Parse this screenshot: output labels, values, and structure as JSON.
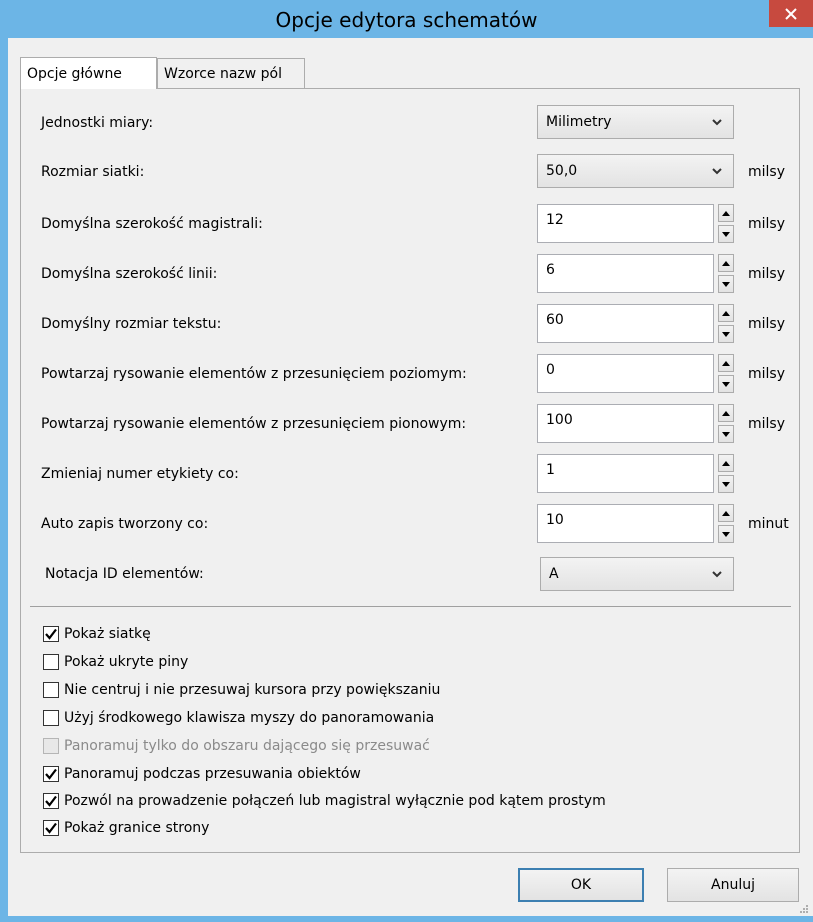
{
  "window": {
    "title": "Opcje edytora schematów"
  },
  "tabs": [
    {
      "label": "Opcje główne",
      "active": true
    },
    {
      "label": "Wzorce nazw pól",
      "active": false
    }
  ],
  "fields": {
    "units": {
      "label": "Jednostki miary:",
      "value": "Milimetry"
    },
    "grid_size": {
      "label": "Rozmiar siatki:",
      "value": "50,0",
      "unit": "milsy"
    },
    "bus_width": {
      "label": "Domyślna szerokość magistrali:",
      "value": "12",
      "unit": "milsy"
    },
    "line_width": {
      "label": "Domyślna szerokość linii:",
      "value": "6",
      "unit": "milsy"
    },
    "text_size": {
      "label": "Domyślny rozmiar tekstu:",
      "value": "60",
      "unit": "milsy"
    },
    "repeat_h": {
      "label": "Powtarzaj rysowanie elementów z przesunięciem poziomym:",
      "value": "0",
      "unit": "milsy"
    },
    "repeat_v": {
      "label": "Powtarzaj rysowanie elementów z przesunięciem pionowym:",
      "value": "100",
      "unit": "milsy"
    },
    "label_step": {
      "label": "Zmieniaj numer etykiety co:",
      "value": "1"
    },
    "autosave": {
      "label": "Auto zapis tworzony co:",
      "value": "10",
      "unit": "minut"
    },
    "id_notation": {
      "label": "Notacja ID elementów:",
      "value": "A"
    }
  },
  "checkboxes": [
    {
      "label": "Pokaż siatkę",
      "checked": true,
      "enabled": true
    },
    {
      "label": "Pokaż ukryte piny",
      "checked": false,
      "enabled": true
    },
    {
      "label": "Nie centruj i nie przesuwaj kursora przy powiększaniu",
      "checked": false,
      "enabled": true
    },
    {
      "label": "Użyj środkowego klawisza myszy do panoramowania",
      "checked": false,
      "enabled": true
    },
    {
      "label": "Panoramuj tylko do obszaru dającego się przesuwać",
      "checked": false,
      "enabled": false
    },
    {
      "label": "Panoramuj podczas przesuwania obiektów",
      "checked": true,
      "enabled": true
    },
    {
      "label": "Pozwól na prowadzenie połączeń lub magistral wyłącznie pod kątem prostym",
      "checked": true,
      "enabled": true
    },
    {
      "label": "Pokaż granice strony",
      "checked": true,
      "enabled": true
    }
  ],
  "buttons": {
    "ok": "OK",
    "cancel": "Anuluj"
  },
  "colors": {
    "frame": "#6cb5e6",
    "close": "#c74a3f",
    "client": "#f0f0f0"
  },
  "icons": {
    "close": "close-icon",
    "dropdown": "chevron-down-icon",
    "spin_up": "triangle-up-icon",
    "spin_down": "triangle-down-icon",
    "check": "checkmark-icon"
  }
}
